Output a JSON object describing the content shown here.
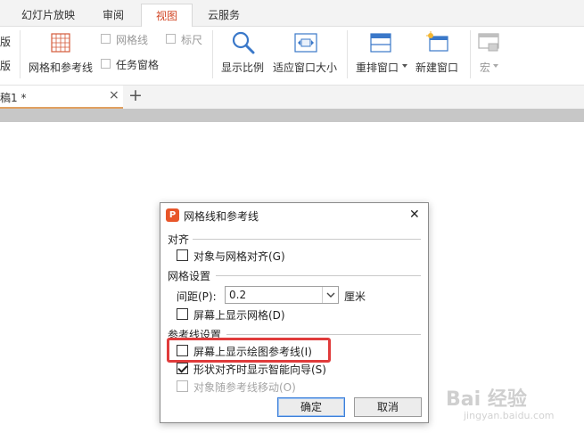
{
  "tabs": [
    {
      "label": "幻灯片放映"
    },
    {
      "label": "审阅"
    },
    {
      "label": "视图"
    },
    {
      "label": "云服务"
    }
  ],
  "ribbon": {
    "left_clipped_1": "版",
    "left_clipped_2": "版",
    "grid_ruler_button": "网格和参考线",
    "grid_checkbox": "网格线",
    "ruler_checkbox": "标尺",
    "task_pane_checkbox": "任务窗格",
    "zoom_button": "显示比例",
    "fit_window_button": "适应窗口大小",
    "arrange_button": "重排窗口",
    "new_window_button": "新建窗口",
    "macro_button": "宏"
  },
  "doc_tab": {
    "title": "稿1 *",
    "close": "×",
    "add": "+"
  },
  "dialog": {
    "title": "网格线和参考线",
    "close": "✕",
    "section_align": "对齐",
    "snap_to_grid": "对象与网格对齐(G)",
    "section_grid": "网格设置",
    "spacing_label": "间距(P):",
    "spacing_value": "0.2",
    "spacing_unit": "厘米",
    "show_grid": "屏幕上显示网格(D)",
    "section_guides": "参考线设置",
    "show_guides": "屏幕上显示绘图参考线(I)",
    "smart_guides": "形状对齐时显示智能向导(S)",
    "move_with_guides": "对象随参考线移动(O)",
    "ok": "确定",
    "cancel": "取消"
  },
  "watermark": {
    "text": "Bai 经验",
    "sub": "jingyan.baidu.com"
  },
  "colors": {
    "accent": "#d24726",
    "highlight_box": "#e03b3b",
    "icon_blue": "#3a78c9"
  }
}
